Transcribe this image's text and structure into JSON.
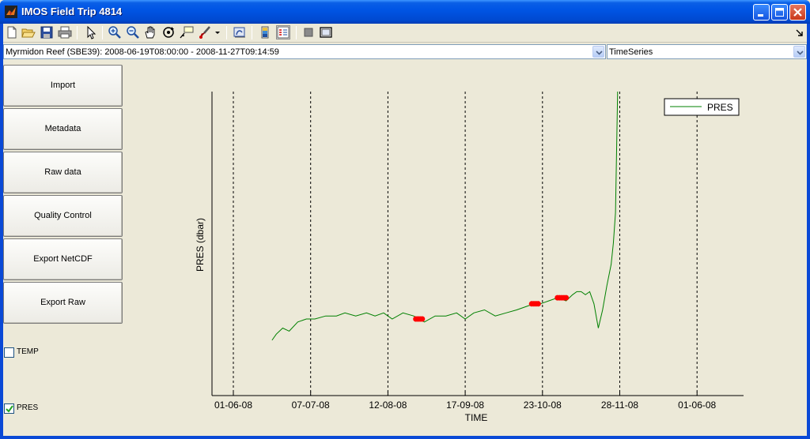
{
  "window": {
    "title": "IMOS Field Trip 4814"
  },
  "toolbar": {
    "items": [
      "new-file-icon",
      "open-file-icon",
      "save-icon",
      "print-icon",
      "pointer-icon",
      "zoom-in-icon",
      "zoom-out-icon",
      "pan-icon",
      "rotate-icon",
      "data-cursor-icon",
      "brush-icon",
      "link-plot-icon",
      "colorbar-icon",
      "legend-icon",
      "grid-icon",
      "figure-palette-icon"
    ]
  },
  "selectors": {
    "dataset": "Myrmidon Reef (SBE39): 2008-06-19T08:00:00 - 2008-11-27T09:14:59",
    "view": "TimeSeries"
  },
  "sidebar": {
    "buttons": [
      {
        "label": "Import"
      },
      {
        "label": "Metadata"
      },
      {
        "label": "Raw data"
      },
      {
        "label": "Quality Control"
      },
      {
        "label": "Export NetCDF"
      },
      {
        "label": "Export Raw"
      }
    ],
    "checkboxes": [
      {
        "label": "TEMP",
        "checked": false
      },
      {
        "label": "PRES",
        "checked": true
      }
    ]
  },
  "chart_data": {
    "type": "line",
    "xlabel": "TIME",
    "ylabel": "PRES (dbar)",
    "x_ticks": [
      "01-06-08",
      "07-07-08",
      "12-08-08",
      "17-09-08",
      "23-10-08",
      "28-11-08",
      "01-06-08"
    ],
    "grid": "vertical-dashed",
    "legend": {
      "position": "top-right",
      "entries": [
        "PRES"
      ]
    },
    "series": [
      {
        "name": "PRES",
        "color": "#008000",
        "x": [
          "2008-06-19",
          "2008-06-21",
          "2008-06-24",
          "2008-06-27",
          "2008-07-01",
          "2008-07-05",
          "2008-07-09",
          "2008-07-14",
          "2008-07-19",
          "2008-07-23",
          "2008-07-28",
          "2008-08-02",
          "2008-08-06",
          "2008-08-10",
          "2008-08-14",
          "2008-08-19",
          "2008-08-24",
          "2008-08-29",
          "2008-09-03",
          "2008-09-08",
          "2008-09-13",
          "2008-09-17",
          "2008-09-21",
          "2008-09-26",
          "2008-10-01",
          "2008-10-06",
          "2008-10-11",
          "2008-10-15",
          "2008-10-19",
          "2008-10-22",
          "2008-10-26",
          "2008-10-30",
          "2008-11-03",
          "2008-11-06",
          "2008-11-08",
          "2008-11-10",
          "2008-11-12",
          "2008-11-14",
          "2008-11-16",
          "2008-11-18",
          "2008-11-20",
          "2008-11-22",
          "2008-11-24",
          "2008-11-25",
          "2008-11-26",
          "2008-11-27"
        ],
        "y": [
          0.18,
          0.2,
          0.22,
          0.21,
          0.24,
          0.25,
          0.25,
          0.26,
          0.26,
          0.27,
          0.26,
          0.27,
          0.26,
          0.27,
          0.25,
          0.27,
          0.26,
          0.24,
          0.26,
          0.26,
          0.27,
          0.25,
          0.27,
          0.28,
          0.26,
          0.27,
          0.28,
          0.29,
          0.3,
          0.3,
          0.31,
          0.32,
          0.31,
          0.33,
          0.34,
          0.34,
          0.33,
          0.34,
          0.3,
          0.22,
          0.28,
          0.36,
          0.43,
          0.5,
          0.6,
          1.0
        ]
      }
    ],
    "flagged_points": {
      "color": "#ff0000",
      "x": [
        "2008-08-25",
        "2008-08-26",
        "2008-08-27",
        "2008-08-28",
        "2008-10-18",
        "2008-10-19",
        "2008-10-20",
        "2008-10-21",
        "2008-10-30",
        "2008-10-31",
        "2008-11-01",
        "2008-11-02",
        "2008-11-03"
      ],
      "y": [
        0.25,
        0.25,
        0.25,
        0.25,
        0.3,
        0.3,
        0.3,
        0.3,
        0.32,
        0.32,
        0.32,
        0.32,
        0.32
      ]
    }
  }
}
